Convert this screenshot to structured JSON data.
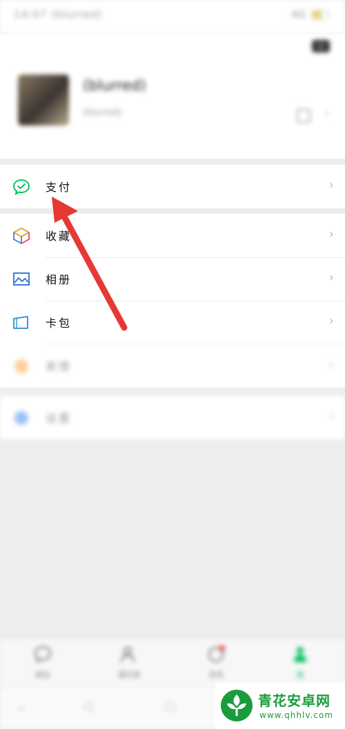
{
  "status_bar": {
    "left_text": "14:07 (blurred)",
    "right_text": "4G"
  },
  "profile": {
    "name": "(blurred)",
    "wechat_id": "(blurred)"
  },
  "menu_primary": [
    {
      "label": "支付",
      "icon": "wechat-pay-icon"
    }
  ],
  "menu_secondary": [
    {
      "label": "收藏",
      "icon": "favorites-cube-icon"
    },
    {
      "label": "相册",
      "icon": "album-picture-icon"
    },
    {
      "label": "卡包",
      "icon": "card-wallet-icon"
    },
    {
      "label": "表情",
      "icon": "sticker-smile-icon"
    }
  ],
  "menu_settings": [
    {
      "label": "设置",
      "icon": "settings-gear-icon"
    }
  ],
  "tabbar": [
    {
      "label": "微信",
      "icon": "chat-bubble-icon"
    },
    {
      "label": "通讯录",
      "icon": "contacts-icon"
    },
    {
      "label": "发现",
      "icon": "discover-compass-icon"
    },
    {
      "label": "我",
      "icon": "me-person-icon"
    }
  ],
  "chevron_glyph": "›",
  "watermark": {
    "title": "青花安卓网",
    "url": "www.qhhlv.com"
  },
  "colors": {
    "wechat_green": "#07c160",
    "arrow_red": "#e53935",
    "watermark_green": "#1a9c3c"
  }
}
